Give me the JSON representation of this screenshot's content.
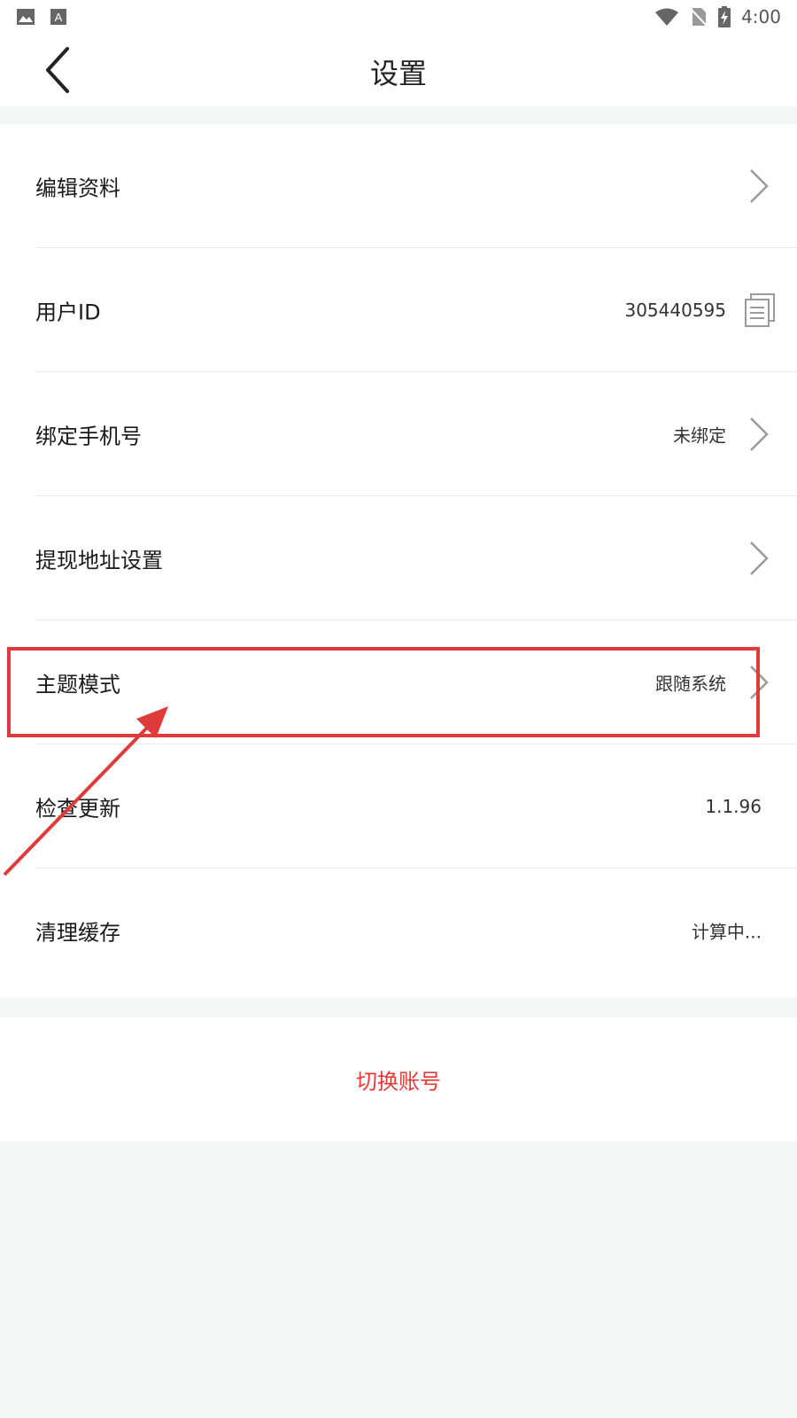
{
  "status_bar": {
    "time": "4:00",
    "icons": [
      "image-icon",
      "text-a-icon",
      "wifi-icon",
      "no-sim-icon",
      "battery-charging-icon"
    ]
  },
  "header": {
    "title": "设置",
    "back_icon": "chevron-left-icon"
  },
  "settings": {
    "items": [
      {
        "label": "编辑资料",
        "value": "",
        "trailing": "chevron-right-icon"
      },
      {
        "label": "用户ID",
        "value": "305440595",
        "trailing": "copy-icon"
      },
      {
        "label": "绑定手机号",
        "value": "未绑定",
        "trailing": "chevron-right-icon"
      },
      {
        "label": "提现地址设置",
        "value": "",
        "trailing": "chevron-right-icon"
      },
      {
        "label": "主题模式",
        "value": "跟随系统",
        "trailing": "chevron-right-icon"
      },
      {
        "label": "检查更新",
        "value": "1.1.96",
        "trailing": ""
      },
      {
        "label": "清理缓存",
        "value": "计算中...",
        "trailing": ""
      }
    ]
  },
  "footer": {
    "switch_account_label": "切换账号"
  },
  "colors": {
    "accent_red": "#e53935",
    "annotation_red": "#e03b3b",
    "background": "#f5f6f6"
  }
}
